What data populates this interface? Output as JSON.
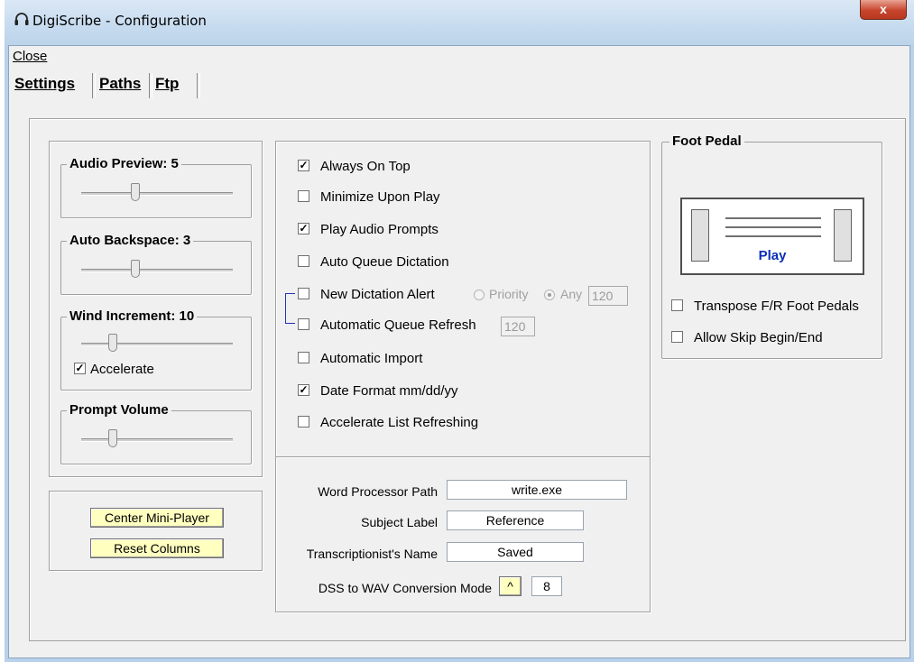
{
  "window": {
    "title": "DigiScribe - Configuration",
    "close_glyph": "x",
    "icon": "headphones-icon"
  },
  "menu": {
    "close_label": "Close"
  },
  "tabs": [
    {
      "label": "Settings",
      "selected": true
    },
    {
      "label": "Paths",
      "selected": false
    },
    {
      "label": "Ftp",
      "selected": false
    }
  ],
  "sliders": {
    "audio_preview": {
      "label": "Audio Preview:  5",
      "value": 5
    },
    "auto_backspace": {
      "label": "Auto Backspace:  3",
      "value": 3
    },
    "wind_increment": {
      "label": "Wind Increment:  10",
      "value": 10
    },
    "prompt_volume": {
      "label": "Prompt Volume"
    }
  },
  "accelerate": {
    "label": "Accelerate",
    "checked": true
  },
  "buttons": {
    "center_mini_player": "Center Mini-Player",
    "reset_columns": "Reset Columns"
  },
  "options": [
    {
      "label": "Always On Top",
      "checked": true
    },
    {
      "label": "Minimize Upon Play",
      "checked": false
    },
    {
      "label": "Play Audio Prompts",
      "checked": true
    },
    {
      "label": "Auto Queue Dictation",
      "checked": false
    },
    {
      "label": "New Dictation Alert",
      "checked": false
    },
    {
      "label": "Automatic Queue Refresh",
      "checked": false
    },
    {
      "label": "Automatic Import",
      "checked": false
    },
    {
      "label": "Date Format mm/dd/yy",
      "checked": true
    },
    {
      "label": "Accelerate List Refreshing",
      "checked": false
    }
  ],
  "alert": {
    "priority_label": "Priority",
    "any_label": "Any",
    "selected": "Any",
    "interval": "120"
  },
  "queue_refresh_interval": "120",
  "fields": {
    "word_processor_label": "Word Processor Path",
    "word_processor_value": "write.exe",
    "subject_label_label": "Subject Label",
    "subject_label_value": "Reference",
    "transcriptionist_label": "Transcriptionist's Name",
    "transcriptionist_value": "Saved",
    "dss_label": "DSS to WAV Conversion Mode",
    "dss_button": "^",
    "dss_value": "8"
  },
  "foot_pedal": {
    "title": "Foot Pedal",
    "play_label": "Play",
    "transpose_label": "Transpose F/R Foot Pedals",
    "transpose_checked": false,
    "allow_skip_label": "Allow Skip Begin/End",
    "allow_skip_checked": false
  },
  "colors": {
    "yellow_button": "#ffffc0",
    "play_text": "#0a2eb8",
    "client_bg": "#f0f0f0"
  }
}
